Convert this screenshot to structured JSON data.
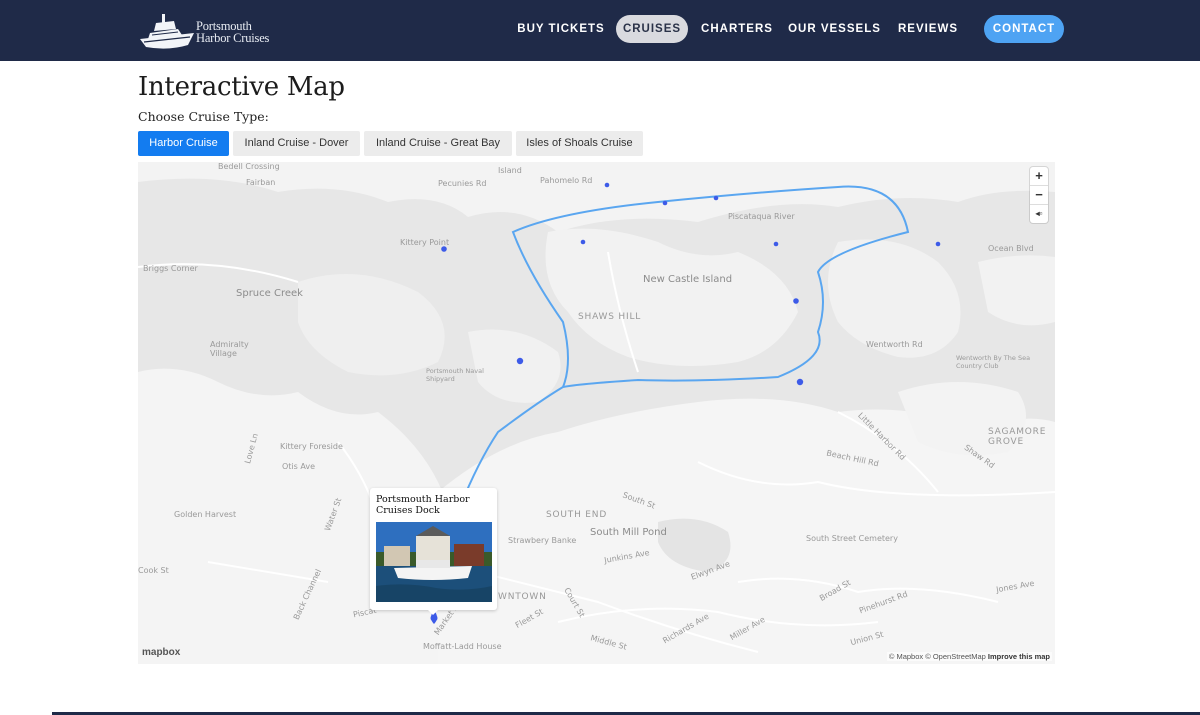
{
  "header": {
    "logo": {
      "line1": "Portsmouth",
      "line2": "Harbor Cruises"
    },
    "nav": [
      {
        "label": "BUY TICKETS"
      },
      {
        "label": "CRUISES"
      },
      {
        "label": "CHARTERS"
      },
      {
        "label": "OUR VESSELS"
      },
      {
        "label": "REVIEWS"
      },
      {
        "label": "CONTACT"
      }
    ],
    "active_nav": "CRUISES",
    "colors": {
      "bar": "#1f2a48",
      "contact": "#4ea3f3",
      "active": "#d9dadf"
    }
  },
  "page": {
    "title": "Interactive Map",
    "choose_label": "Choose Cruise Type:",
    "tabs": [
      {
        "label": "Harbor Cruise"
      },
      {
        "label": "Inland Cruise - Dover"
      },
      {
        "label": "Inland Cruise - Great Bay"
      },
      {
        "label": "Isles of Shoals Cruise"
      }
    ],
    "active_tab": "Harbor Cruise",
    "accent": "#137cf0"
  },
  "map": {
    "labels": {
      "bedell": "Bedell Crossing",
      "fairbanks": "Fairban",
      "pecunies": "Pecunies Rd",
      "island": "Island",
      "pahomelo": "Pahomelo Rd",
      "piscataqua": "Piscataqua River",
      "kittery_point": "Kittery Point",
      "briggs": "Briggs Corner",
      "spruce_creek": "Spruce Creek",
      "new_castle": "New Castle Island",
      "shaws_hill": "SHAWS HILL",
      "admiralty": "Admiralty Village",
      "naval": "Portsmouth Naval Shipyard",
      "kittery_foreside": "Kittery Foreside",
      "golden_harvest": "Golden Harvest",
      "south_end": "SOUTH END",
      "south_mill": "South Mill Pond",
      "strawbery": "Strawbery Banke",
      "wentworth_rd": "Wentworth Rd",
      "little_harbor": "Little Harbor Rd",
      "sagamore": "SAGAMORE GROVE",
      "south_st": "South St",
      "market": "Market St",
      "middle": "Middle St",
      "moffatt": "Moffatt-Ladd House",
      "court": "Court St",
      "richards": "Richards Ave",
      "miller": "Miller Ave",
      "broad": "Broad St",
      "pinehurst": "Pinehurst Rd",
      "union": "Union St",
      "cook": "Cook St",
      "jones": "Jones Ave",
      "downtown": "WNTOWN",
      "piscat2": "Piscat",
      "ocean_blvd": "Ocean Blvd",
      "wentworth_sea": "Wentworth By The Sea Country Club",
      "cemetery": "South Street Cemetery",
      "elwyn": "Elwyn Ave",
      "junkins": "Junkins Ave",
      "fleet": "Fleet St",
      "back_channel": "Back Channel",
      "water_st": "Water St",
      "love_ln": "Love Ln",
      "otis": "Otis Ave",
      "shaw_rd": "Shaw Rd",
      "beach_hill": "Beach Hill Rd"
    },
    "popup": {
      "title": "Portsmouth Harbor Cruises Dock"
    },
    "zoom": {
      "in": "+",
      "out": "−",
      "compass": "◂▫"
    },
    "logo": "mapbox",
    "attribution": "© Mapbox © OpenStreetMap",
    "attribution_link": "Improve this map",
    "route_color": "#5aa6f0",
    "marker_color": "#3d5be8"
  }
}
